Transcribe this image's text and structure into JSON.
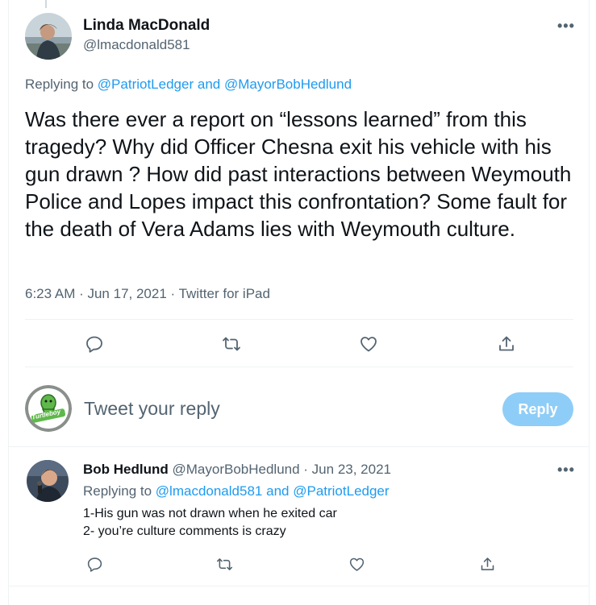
{
  "tweet": {
    "author_name": "Linda MacDonald",
    "author_handle": "@lmacdonald581",
    "more_label": "•••",
    "replying_prefix": "Replying to",
    "replying_to_1": "@PatriotLedger",
    "replying_joiner": "and",
    "replying_to_2": "@MayorBobHedlund",
    "text": "Was there ever a report on “lessons learned” from this tragedy? Why did Officer Chesna exit his vehicle with his gun drawn ? How did past interactions between Weymouth Police and Lopes impact this confrontation? Some fault  for the death of Vera Adams lies with Weymouth culture.",
    "meta": "6:23 AM · Jun 17, 2021 · Twitter for iPad"
  },
  "composer": {
    "placeholder": "Tweet your reply",
    "reply_button": "Reply",
    "avatar_text": "Turtleboy"
  },
  "reply": {
    "author_name": "Bob Hedlund",
    "author_handle": "@MayorBobHedlund",
    "date": " · Jun 23, 2021",
    "more_label": "•••",
    "replying_prefix": "Replying to",
    "replying_to_1": "@lmacdonald581",
    "replying_joiner": "and",
    "replying_to_2": "@PatriotLedger",
    "line1": "1-His gun was not drawn when he exited car",
    "line2": "2- you’re culture comments is crazy"
  },
  "colors": {
    "link": "#1d9bf0",
    "muted": "#536471",
    "reply_button_bg": "#8ecdf7"
  },
  "icons": [
    "reply-icon",
    "retweet-icon",
    "like-icon",
    "share-icon"
  ]
}
